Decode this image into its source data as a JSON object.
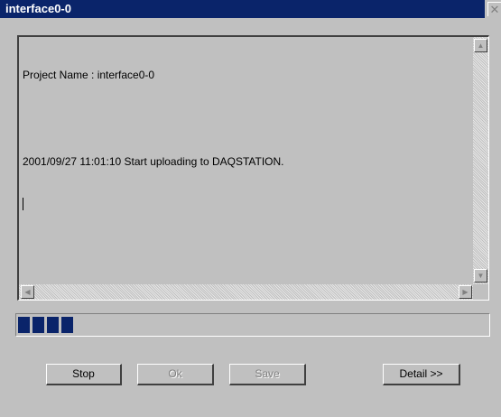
{
  "window": {
    "title": "interface0-0",
    "close_glyph": "✕"
  },
  "log": {
    "lines": [
      "Project Name : interface0-0",
      "",
      "2001/09/27 11:01:10 Start uploading to DAQSTATION."
    ]
  },
  "scrollbars": {
    "up_icon": "▲",
    "down_icon": "▼",
    "left_icon": "◀",
    "right_icon": "▶"
  },
  "progress": {
    "filled_blocks": 4,
    "accent_color": "#0a246a"
  },
  "buttons": {
    "stop_label": "Stop",
    "ok_label": "Ok",
    "save_label": "Save",
    "detail_label": "Detail >>"
  }
}
